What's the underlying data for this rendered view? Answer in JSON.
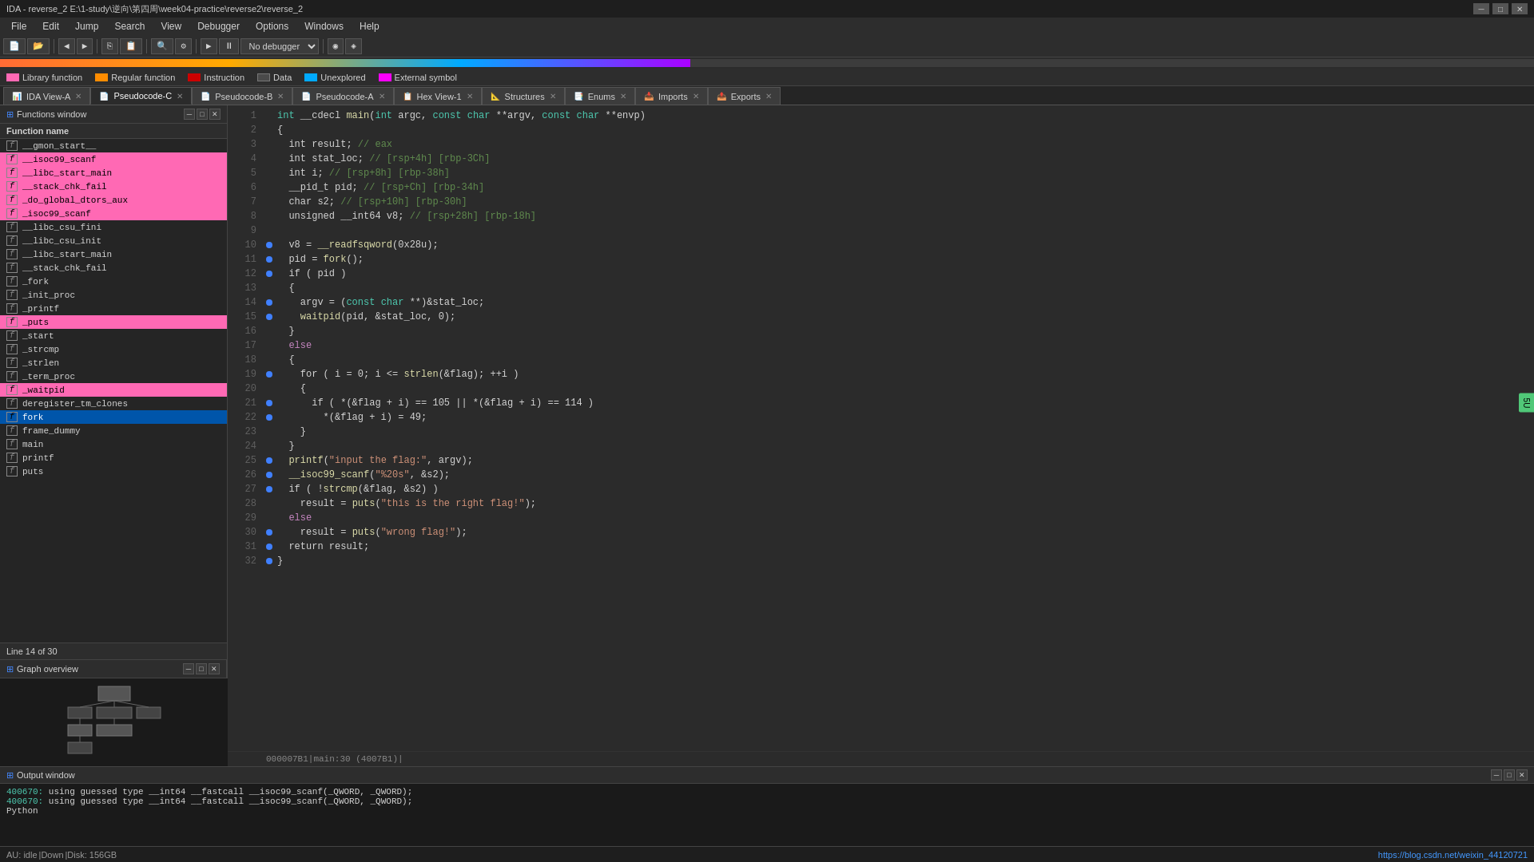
{
  "titlebar": {
    "title": "IDA - reverse_2 E:\\1-study\\逆向\\第四周\\week04-practice\\reverse2\\reverse_2"
  },
  "menubar": {
    "items": [
      "File",
      "Edit",
      "Jump",
      "Search",
      "View",
      "Debugger",
      "Options",
      "Windows",
      "Help"
    ]
  },
  "toolbar": {
    "debugger_label": "No debugger"
  },
  "legend": {
    "items": [
      {
        "color": "#ff69b4",
        "label": "Library function"
      },
      {
        "color": "#ff8c00",
        "label": "Regular function"
      },
      {
        "color": "#cc0000",
        "label": "Instruction"
      },
      {
        "color": "#4a4a4a",
        "label": "Data"
      },
      {
        "color": "#00aaff",
        "label": "Unexplored"
      },
      {
        "color": "#ff00ff",
        "label": "External symbol"
      }
    ]
  },
  "tabs": [
    {
      "id": "ida-view-a",
      "label": "IDA View-A",
      "active": false,
      "icon": "📊"
    },
    {
      "id": "pseudocode-c",
      "label": "Pseudocode-C",
      "active": true,
      "icon": "📄"
    },
    {
      "id": "pseudocode-b",
      "label": "Pseudocode-B",
      "active": false,
      "icon": "📄"
    },
    {
      "id": "pseudocode-a",
      "label": "Pseudocode-A",
      "active": false,
      "icon": "📄"
    },
    {
      "id": "hex-view-1",
      "label": "Hex View-1",
      "active": false,
      "icon": "📋"
    },
    {
      "id": "structures",
      "label": "Structures",
      "active": false,
      "icon": "📐"
    },
    {
      "id": "enums",
      "label": "Enums",
      "active": false,
      "icon": "📑"
    },
    {
      "id": "imports",
      "label": "Imports",
      "active": false,
      "icon": "📥"
    },
    {
      "id": "exports",
      "label": "Exports",
      "active": false,
      "icon": "📤"
    }
  ],
  "functions_panel": {
    "title": "Functions window",
    "column_header": "Function name",
    "line_info": "Line 14 of 30",
    "functions": [
      {
        "name": "__gmon_start__",
        "highlighted": false
      },
      {
        "name": "__isoc99_scanf",
        "highlighted": true
      },
      {
        "name": "__libc_start_main",
        "highlighted": true
      },
      {
        "name": "__stack_chk_fail",
        "highlighted": true
      },
      {
        "name": "_do_global_dtors_aux",
        "highlighted": true
      },
      {
        "name": "_isoc99_scanf",
        "highlighted": true
      },
      {
        "name": "__libc_csu_fini",
        "highlighted": false
      },
      {
        "name": "__libc_csu_init",
        "highlighted": false
      },
      {
        "name": "__libc_start_main",
        "highlighted": false
      },
      {
        "name": "__stack_chk_fail",
        "highlighted": false
      },
      {
        "name": "_fork",
        "highlighted": false
      },
      {
        "name": "_init_proc",
        "highlighted": false
      },
      {
        "name": "_printf",
        "highlighted": false
      },
      {
        "name": "_puts",
        "highlighted": true
      },
      {
        "name": "_start",
        "highlighted": false
      },
      {
        "name": "_strcmp",
        "highlighted": false
      },
      {
        "name": "_strlen",
        "highlighted": false
      },
      {
        "name": "_term_proc",
        "highlighted": false
      },
      {
        "name": "_waitpid",
        "highlighted": true
      },
      {
        "name": "deregister_tm_clones",
        "highlighted": false
      },
      {
        "name": "fork",
        "highlighted": true,
        "selected": true
      },
      {
        "name": "frame_dummy",
        "highlighted": false
      },
      {
        "name": "main",
        "highlighted": false
      },
      {
        "name": "printf",
        "highlighted": false
      },
      {
        "name": "puts",
        "highlighted": false
      }
    ]
  },
  "graph_panel": {
    "title": "Graph overview"
  },
  "code": {
    "address_bar": "000007B1|main:30 (4007B1)|",
    "lines": [
      {
        "num": 1,
        "dot": false,
        "text": "int __cdecl main(int argc, const char **argv, const char **envp)",
        "segments": [
          {
            "text": "int ",
            "class": "c-cyan"
          },
          {
            "text": "__cdecl ",
            "class": "c-white"
          },
          {
            "text": "main",
            "class": "c-yellow"
          },
          {
            "text": "(int ",
            "class": "c-white"
          },
          {
            "text": "argc, const char **argv, const char **envp)",
            "class": "c-white"
          }
        ]
      },
      {
        "num": 2,
        "dot": false,
        "text": "{",
        "color": "c-white"
      },
      {
        "num": 3,
        "dot": false,
        "text": "  int result; // eax",
        "color": "c-white"
      },
      {
        "num": 4,
        "dot": false,
        "text": "  int stat_loc; // [rsp+4h] [rbp-3Ch]",
        "color": "c-white"
      },
      {
        "num": 5,
        "dot": false,
        "text": "  int i; // [rsp+8h] [rbp-38h]",
        "color": "c-white"
      },
      {
        "num": 6,
        "dot": false,
        "text": "  __pid_t pid; // [rsp+Ch] [rbp-34h]",
        "color": "c-white"
      },
      {
        "num": 7,
        "dot": false,
        "text": "  char s2; // [rsp+10h] [rbp-30h]",
        "color": "c-white"
      },
      {
        "num": 8,
        "dot": false,
        "text": "  unsigned __int64 v8; // [rsp+28h] [rbp-18h]",
        "color": "c-white"
      },
      {
        "num": 9,
        "dot": false,
        "text": "",
        "color": "c-white"
      },
      {
        "num": 10,
        "dot": true,
        "text": "  v8 = __readfsqword(0x28u);",
        "color": "c-white"
      },
      {
        "num": 11,
        "dot": true,
        "text": "  pid = fork();",
        "color": "c-white"
      },
      {
        "num": 12,
        "dot": true,
        "text": "  if ( pid )",
        "color": "c-white"
      },
      {
        "num": 13,
        "dot": false,
        "text": "  {",
        "color": "c-white"
      },
      {
        "num": 14,
        "dot": true,
        "text": "    argv = (const char **)&stat_loc;",
        "color": "c-white"
      },
      {
        "num": 15,
        "dot": true,
        "text": "    waitpid(pid, &stat_loc, 0);",
        "color": "c-white"
      },
      {
        "num": 16,
        "dot": false,
        "text": "  }",
        "color": "c-white"
      },
      {
        "num": 17,
        "dot": false,
        "text": "  else",
        "color": "c-pink"
      },
      {
        "num": 18,
        "dot": false,
        "text": "  {",
        "color": "c-white"
      },
      {
        "num": 19,
        "dot": true,
        "text": "    for ( i = 0; i <= strlen(&flag); ++i )",
        "color": "c-white"
      },
      {
        "num": 20,
        "dot": false,
        "text": "    {",
        "color": "c-white"
      },
      {
        "num": 21,
        "dot": true,
        "text": "      if ( *(&flag + i) == 105 || *(&flag + i) == 114 )",
        "color": "c-white"
      },
      {
        "num": 22,
        "dot": true,
        "text": "        *(&flag + i) = 49;",
        "color": "c-white"
      },
      {
        "num": 23,
        "dot": false,
        "text": "    }",
        "color": "c-white"
      },
      {
        "num": 24,
        "dot": false,
        "text": "  }",
        "color": "c-white"
      },
      {
        "num": 25,
        "dot": true,
        "text": "  printf(\"input the flag:\", argv);",
        "color": "c-white"
      },
      {
        "num": 26,
        "dot": true,
        "text": "  __isoc99_scanf(\"%20s\", &s2);",
        "color": "c-white"
      },
      {
        "num": 27,
        "dot": true,
        "text": "  if ( !strcmp(&flag, &s2) )",
        "color": "c-white"
      },
      {
        "num": 28,
        "dot": false,
        "text": "    result = puts(\"this is the right flag!\");",
        "color": "c-white"
      },
      {
        "num": 29,
        "dot": false,
        "text": "  else",
        "color": "c-pink"
      },
      {
        "num": 30,
        "dot": true,
        "text": "    result = puts(\"wrong flag!\");",
        "color": "c-white"
      },
      {
        "num": 31,
        "dot": true,
        "text": "  return result;",
        "color": "c-white"
      },
      {
        "num": 32,
        "dot": true,
        "text": "}",
        "color": "c-white"
      }
    ]
  },
  "output_panel": {
    "title": "Output window",
    "lines": [
      "400670: using guessed type __int64 __fastcall __isoc99_scanf(_QWORD, _QWORD);",
      "400670: using guessed type __int64 __fastcall __isoc99_scanf(_QWORD, _QWORD);",
      "Python"
    ]
  },
  "status_bar": {
    "idle": "AU: idle",
    "down": "|Down",
    "disk": "|Disk: 156GB",
    "link": "https://blog.csdn.net/weixin_44120721"
  }
}
